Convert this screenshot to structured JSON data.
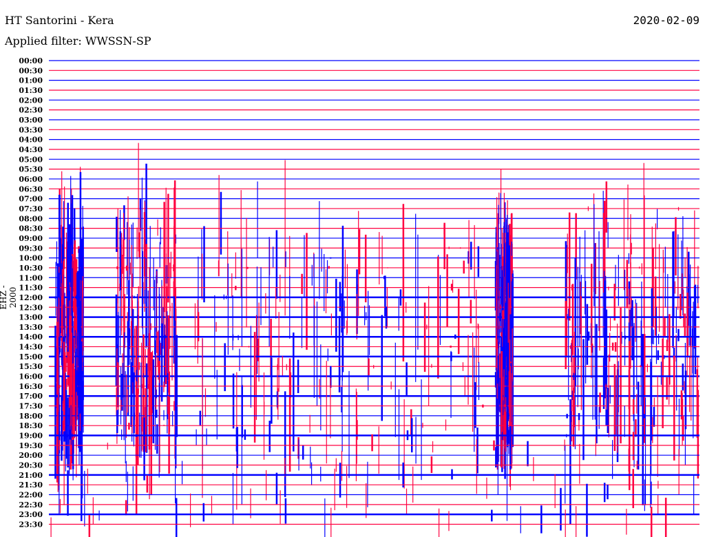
{
  "header": {
    "title": "HT Santorini - Kera",
    "date": "2020-02-09",
    "filter": "Applied filter: WWSSN-SP",
    "channel": "EHZ - 2000"
  },
  "chart_data": {
    "type": "line",
    "title": "HT Santorini - Kera",
    "subtitle": "Applied filter: WWSSN-SP",
    "ylabel": "EHZ - 2000",
    "xlabel": "",
    "row_minutes": 30,
    "row_labels": [
      "00:00",
      "00:30",
      "01:00",
      "01:30",
      "02:00",
      "02:30",
      "03:00",
      "03:30",
      "04:00",
      "04:30",
      "05:00",
      "05:30",
      "06:00",
      "06:30",
      "07:00",
      "07:30",
      "08:00",
      "08:30",
      "09:00",
      "09:30",
      "10:00",
      "10:30",
      "11:00",
      "11:30",
      "12:00",
      "12:30",
      "13:00",
      "13:30",
      "14:00",
      "14:30",
      "15:00",
      "15:30",
      "16:00",
      "16:30",
      "17:00",
      "17:30",
      "18:00",
      "18:30",
      "19:00",
      "19:30",
      "20:00",
      "20:30",
      "21:00",
      "21:30",
      "22:00",
      "22:30",
      "23:00",
      "23:30"
    ],
    "row_colors": [
      "#0000ff",
      "#ff0040"
    ],
    "active_minute_windows": [
      [
        0.3,
        1.6
      ],
      [
        3.1,
        5.9
      ],
      [
        6.7,
        20.1
      ],
      [
        20.6,
        21.4
      ],
      [
        23.8,
        30.0
      ]
    ],
    "swarm_rows": [
      19,
      38
    ],
    "late_event_rows": [
      39,
      47
    ]
  }
}
